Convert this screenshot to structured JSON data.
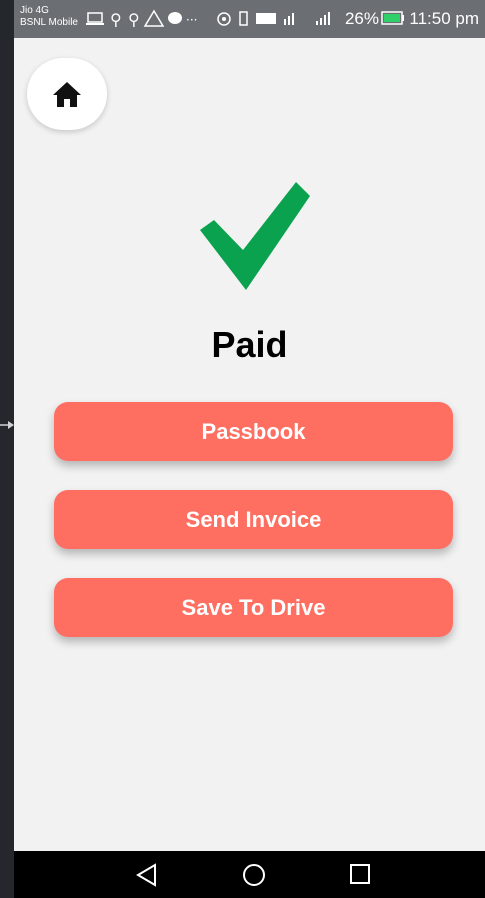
{
  "status_bar": {
    "carrier_line1": "Jio 4G",
    "carrier_line2": "BSNL Mobile",
    "battery": "26%",
    "time": "11:50 pm"
  },
  "page": {
    "title": "Paid",
    "buttons": {
      "passbook": "Passbook",
      "send_invoice": "Send Invoice",
      "save_to_drive": "Save To Drive"
    }
  },
  "icons": {
    "home": "home-icon",
    "check": "checkmark-icon",
    "back": "back-icon",
    "home_nav": "home-nav-icon",
    "recents": "recents-icon"
  },
  "colors": {
    "button": "#ff6f61",
    "check": "#0aa24f",
    "background": "#f2f2f2"
  }
}
